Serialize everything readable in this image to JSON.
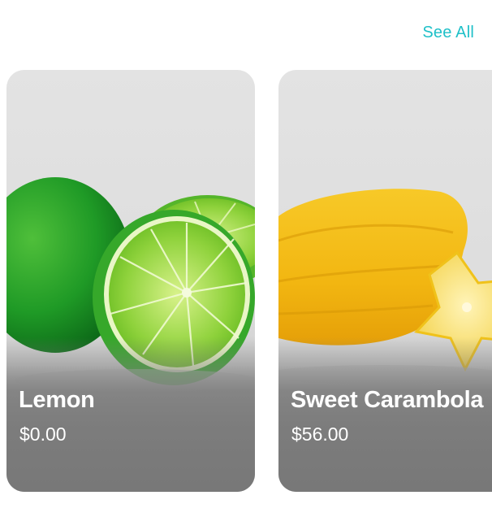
{
  "header": {
    "see_all_label": "See All"
  },
  "products": [
    {
      "name": "Lemon",
      "price": "$0.00",
      "image": "green-lime-halves"
    },
    {
      "name": "Sweet Carambola",
      "price": "$56.00",
      "image": "yellow-starfruit"
    }
  ],
  "colors": {
    "accent": "#1fc0c8",
    "card_bg": "#e0e0e0",
    "overlay": "#7a7a7a",
    "text_on_card": "#ffffff"
  }
}
